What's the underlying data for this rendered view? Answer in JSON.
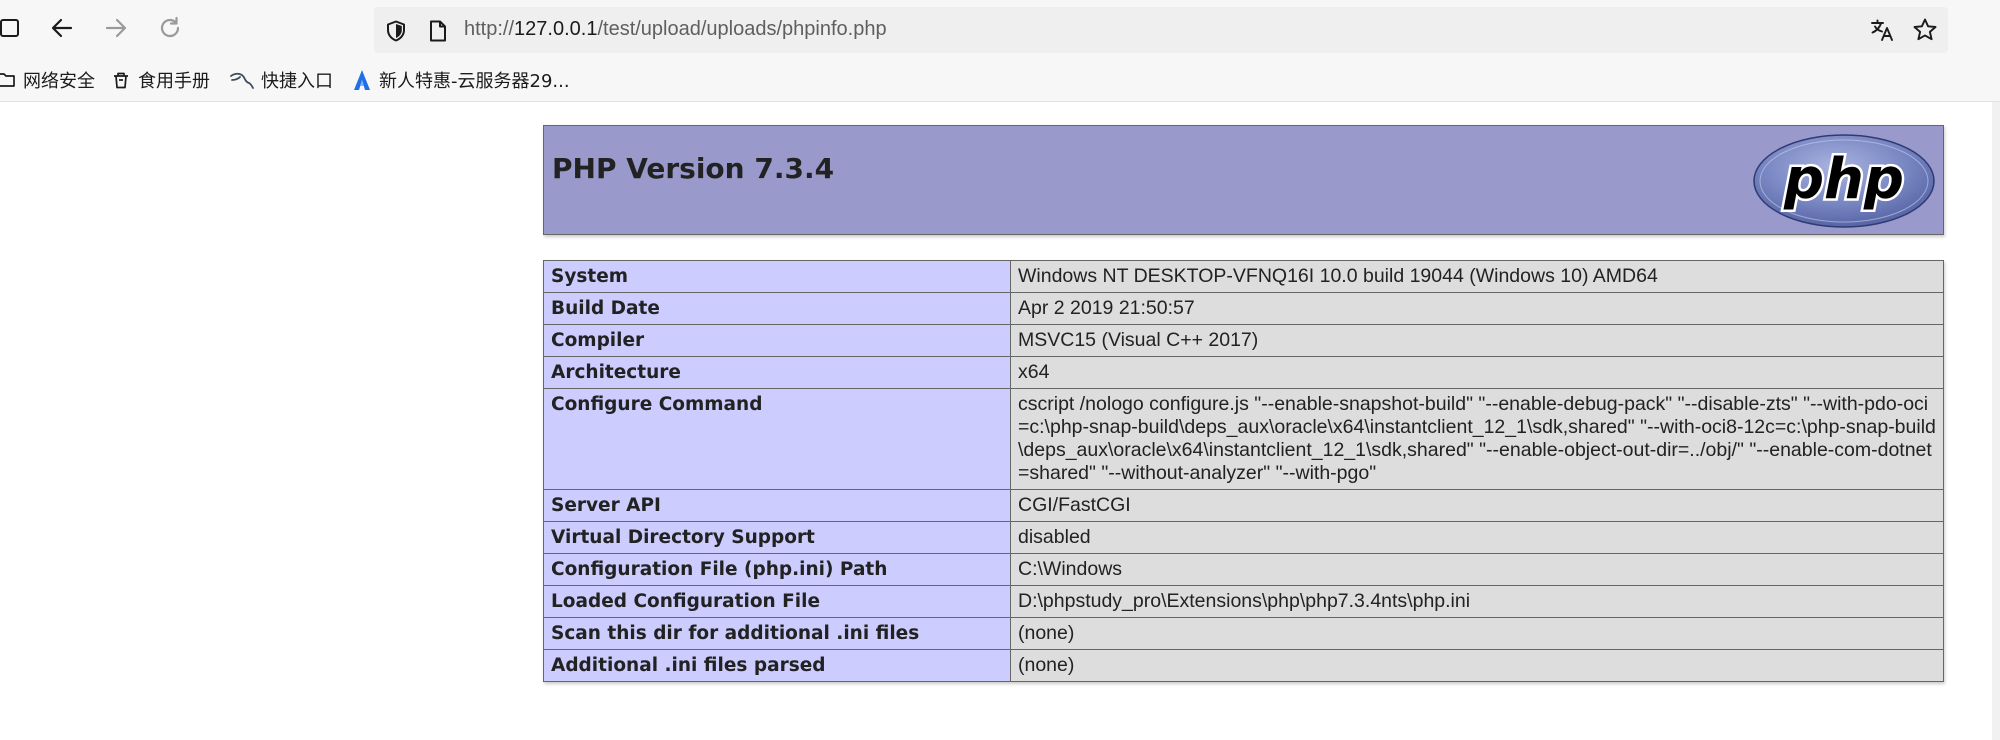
{
  "browser": {
    "url_prefix": "http://",
    "url_host": "127.0.0.1",
    "url_path": "/test/upload/uploads/phpinfo.php",
    "bookmarks": [
      {
        "label": "网络安全",
        "icon": "folder-icon"
      },
      {
        "label": "食用手册",
        "icon": "trash-icon"
      },
      {
        "label": "快捷入口",
        "icon": "kali-dragon-icon"
      },
      {
        "label": "新人特惠-云服务器29...",
        "icon": "cloud-service-icon"
      }
    ]
  },
  "phpinfo": {
    "title": "PHP Version 7.3.4",
    "logo_text": "php",
    "rows": [
      {
        "key": "System",
        "value": "Windows NT DESKTOP-VFNQ16I 10.0 build 19044 (Windows 10) AMD64"
      },
      {
        "key": "Build Date",
        "value": "Apr 2 2019 21:50:57"
      },
      {
        "key": "Compiler",
        "value": "MSVC15 (Visual C++ 2017)"
      },
      {
        "key": "Architecture",
        "value": "x64"
      },
      {
        "key": "Configure Command",
        "value": "cscript /nologo configure.js \"--enable-snapshot-build\" \"--enable-debug-pack\" \"--disable-zts\" \"--with-pdo-oci=c:\\php-snap-build\\deps_aux\\oracle\\x64\\instantclient_12_1\\sdk,shared\" \"--with-oci8-12c=c:\\php-snap-build\\deps_aux\\oracle\\x64\\instantclient_12_1\\sdk,shared\" \"--enable-object-out-dir=../obj/\" \"--enable-com-dotnet=shared\" \"--without-analyzer\" \"--with-pgo\""
      },
      {
        "key": "Server API",
        "value": "CGI/FastCGI"
      },
      {
        "key": "Virtual Directory Support",
        "value": "disabled"
      },
      {
        "key": "Configuration File (php.ini) Path",
        "value": "C:\\Windows"
      },
      {
        "key": "Loaded Configuration File",
        "value": "D:\\phpstudy_pro\\Extensions\\php\\php7.3.4nts\\php.ini"
      },
      {
        "key": "Scan this dir for additional .ini files",
        "value": "(none)"
      },
      {
        "key": "Additional .ini files parsed",
        "value": "(none)"
      }
    ]
  },
  "colors": {
    "header_bg": "#9999cc",
    "key_cell_bg": "#ccccff",
    "value_cell_bg": "#dddddd",
    "border": "#666666",
    "logo_bg": "#6c7eb7"
  }
}
